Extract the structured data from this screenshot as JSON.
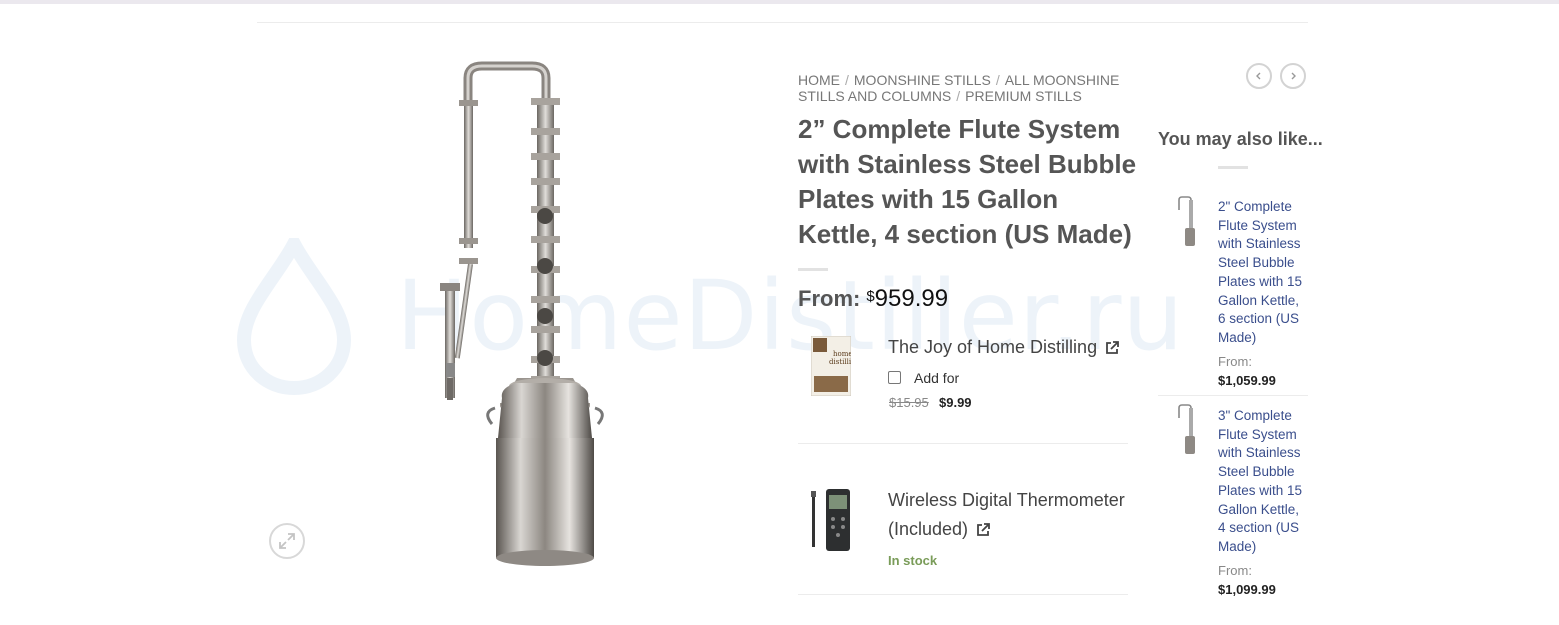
{
  "watermark": {
    "text": "HomeDistiller.ru"
  },
  "breadcrumb": [
    {
      "label": "HOME"
    },
    {
      "label": "MOONSHINE STILLS"
    },
    {
      "label": "ALL MOONSHINE STILLS AND COLUMNS"
    },
    {
      "label": "PREMIUM STILLS"
    }
  ],
  "product": {
    "title": "2” Complete Flute System with Stainless Steel Bubble Plates with 15 Gallon Kettle, 4 section (US Made)",
    "price_prefix": "From:",
    "currency": "$",
    "price": "959.99"
  },
  "addons": [
    {
      "name": "The Joy of Home Distilling",
      "checkbox_label": "Add for",
      "old_price": "$15.95",
      "new_price": "$9.99",
      "checked": false
    },
    {
      "name": "Wireless Digital Thermometer (Included)",
      "stock": "In stock"
    }
  ],
  "sidebar": {
    "title": "You may also like...",
    "items": [
      {
        "name": "2\" Complete Flute System with Stainless Steel Bubble Plates with 15 Gallon Kettle, 6 section (US Made)",
        "from": "From:",
        "price": "$1,059.99"
      },
      {
        "name": "3\" Complete Flute System with Stainless Steel Bubble Plates with 15 Gallon Kettle, 4 section (US Made)",
        "from": "From:",
        "price": "$1,099.99"
      }
    ]
  },
  "icons": {
    "zoom": "expand-icon",
    "external": "external-link-icon",
    "prev": "chevron-left-icon",
    "next": "chevron-right-icon"
  },
  "colors": {
    "in_stock": "#7a9c59",
    "product_link": "#3a4e8c",
    "watermark": "#edf3f9"
  }
}
